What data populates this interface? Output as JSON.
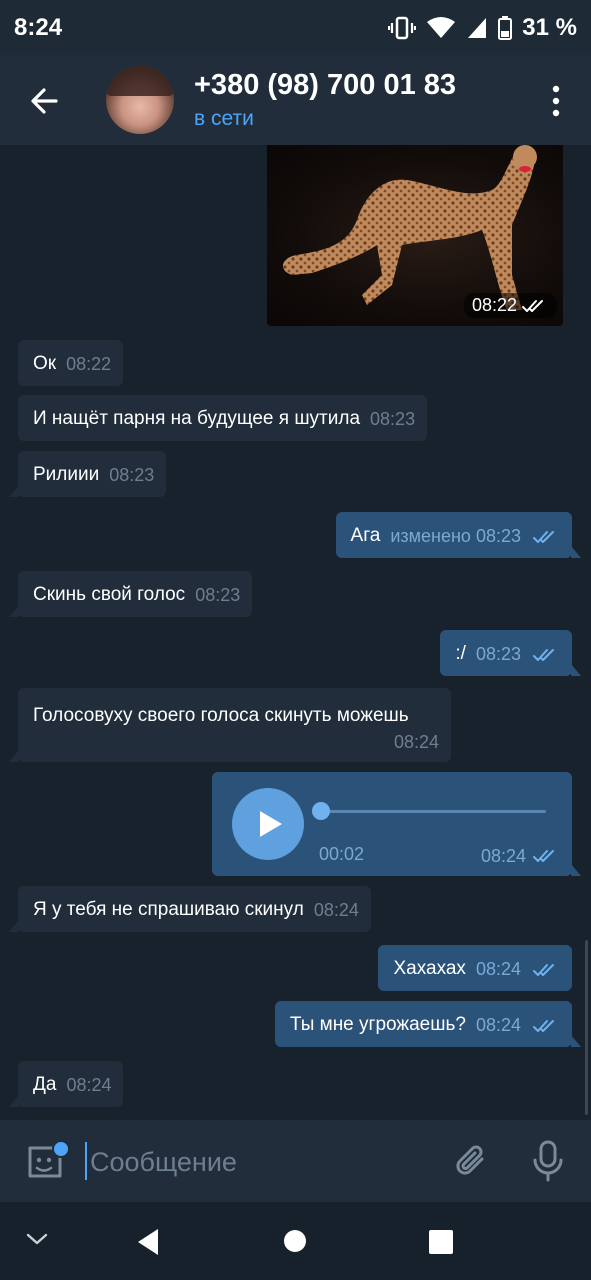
{
  "status_bar": {
    "time": "8:24",
    "battery": "31 %"
  },
  "header": {
    "title": "+380 (98) 700 01 83",
    "subtitle": "в сети"
  },
  "messages": [
    {
      "dir": "out",
      "type": "image",
      "time": "08:22",
      "read": true
    },
    {
      "dir": "in",
      "text": "Ок",
      "time": "08:22"
    },
    {
      "dir": "in",
      "text": "И нащёт парня на будущее я шутила",
      "time": "08:23"
    },
    {
      "dir": "in",
      "text": "Рилиии",
      "time": "08:23"
    },
    {
      "dir": "out",
      "text": "Ага",
      "edited": "изменено",
      "time": "08:23",
      "read": true
    },
    {
      "dir": "in",
      "text": "Скинь свой голос",
      "time": "08:23"
    },
    {
      "dir": "out",
      "text": ":/",
      "time": "08:23",
      "read": true
    },
    {
      "dir": "in",
      "text": "Голосовуху своего голоса скинуть можешь",
      "time": "08:24"
    },
    {
      "dir": "out",
      "type": "voice",
      "duration": "00:02",
      "time": "08:24",
      "read": true
    },
    {
      "dir": "in",
      "text": "Я у тебя не спрашиваю скинул",
      "time": "08:24"
    },
    {
      "dir": "out",
      "text": "Хахахах",
      "time": "08:24",
      "read": true
    },
    {
      "dir": "out",
      "text": "Ты мне угрожаешь?",
      "time": "08:24",
      "read": true
    },
    {
      "dir": "in",
      "text": "Да",
      "time": "08:24"
    }
  ],
  "input": {
    "placeholder": "Сообщение"
  },
  "colors": {
    "background": "#18222d",
    "incoming_bubble": "#212d3b",
    "outgoing_bubble": "#2b5278",
    "accent": "#4ea4f6"
  },
  "icons": {
    "back": "arrow-left-icon",
    "menu": "more-vertical-icon",
    "emoji": "sticker-icon",
    "attach": "paperclip-icon",
    "mic": "microphone-icon"
  }
}
